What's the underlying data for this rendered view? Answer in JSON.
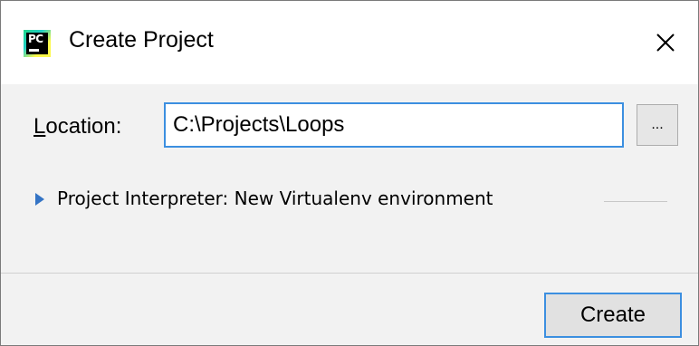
{
  "window": {
    "title": "Create Project",
    "app_icon_text": "PC"
  },
  "form": {
    "location_label_mnemonic": "L",
    "location_label_rest": "ocation:",
    "location_value": "C:\\Projects\\Loops",
    "browse_label": "...",
    "interpreter_label": "Project Interpreter: New Virtualenv environment"
  },
  "footer": {
    "create_label": "Create"
  },
  "colors": {
    "accent": "#3c8fe0",
    "triangle": "#3474c5",
    "content_background": "#f2f2f2",
    "titlebar_background": "#ffffff"
  }
}
